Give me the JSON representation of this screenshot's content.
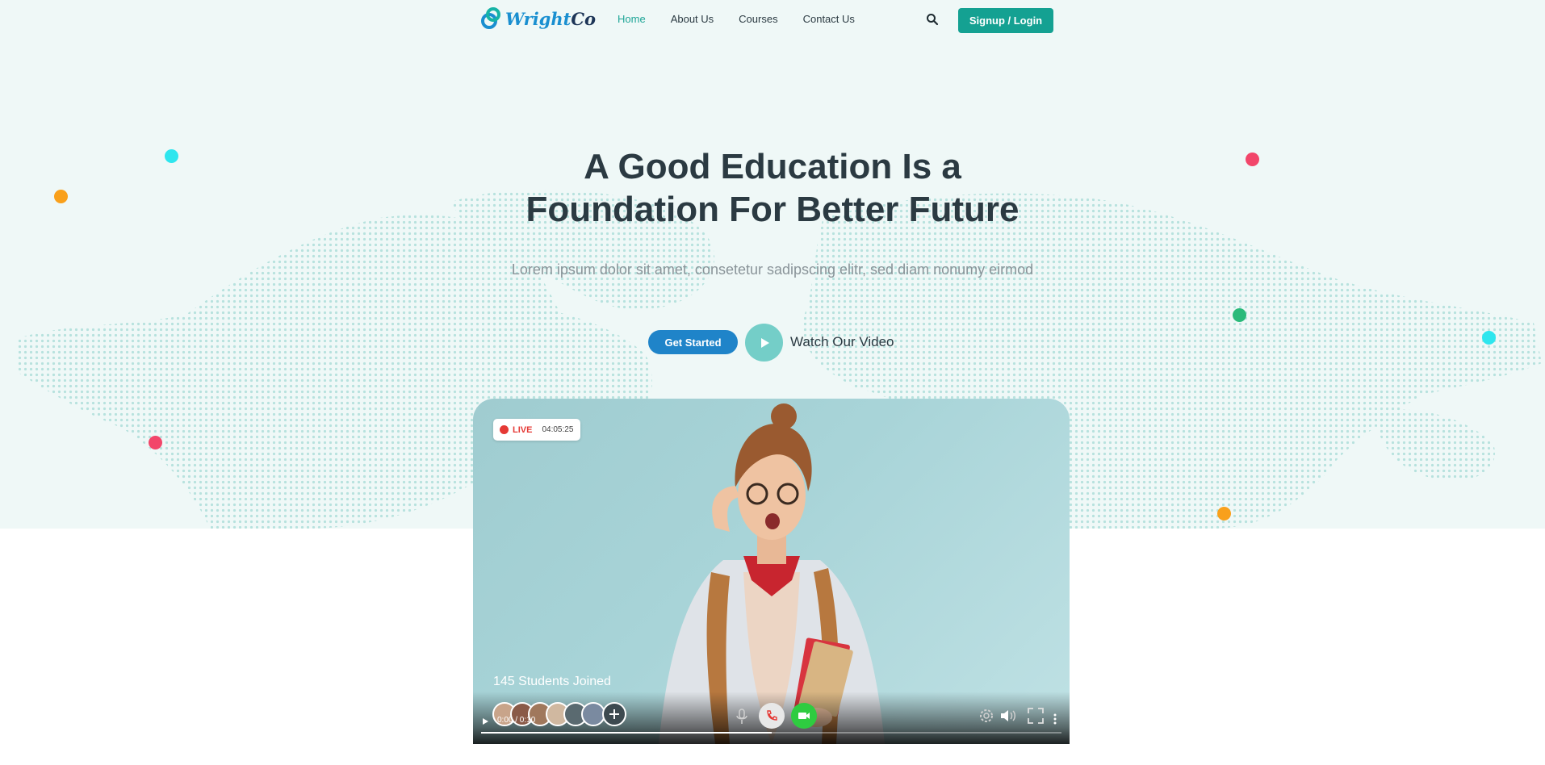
{
  "header": {
    "logo_text_main": "Wright",
    "logo_text_suffix": "Co",
    "nav": [
      {
        "label": "Home",
        "active": true
      },
      {
        "label": "About Us",
        "active": false
      },
      {
        "label": "Courses",
        "active": false
      },
      {
        "label": "Contact Us",
        "active": false
      }
    ],
    "search_icon": "search-icon",
    "signup_label": "Signup / Login"
  },
  "hero": {
    "title_line1": "A Good Education Is a",
    "title_line2": "Foundation For Better Future",
    "subtitle": "Lorem ipsum dolor sit amet, consetetur sadipscing elitr, sed diam nonumy eirmod",
    "get_started_label": "Get Started",
    "watch_label": "Watch Our Video",
    "play_icon": "play-icon"
  },
  "video": {
    "live_label": "LIVE",
    "live_time": "04:05:25",
    "joined_text": "145 Students Joined",
    "time_display": "0:00 / 0:10",
    "progress": 0.5,
    "add_icon": "plus-icon",
    "controls": [
      "play-icon",
      "mic-icon",
      "phone-icon",
      "camera-icon",
      "settings-icon",
      "volume-icon",
      "fullscreen-icon",
      "more-icon"
    ]
  },
  "colors": {
    "accent_teal": "#14a192",
    "accent_blue": "#1f84c9",
    "hero_bg": "#eff8f7",
    "dot_cyan": "#2ee6ee",
    "dot_orange": "#f9a01b",
    "dot_pink": "#f2466a",
    "dot_green": "#2aba7a"
  }
}
